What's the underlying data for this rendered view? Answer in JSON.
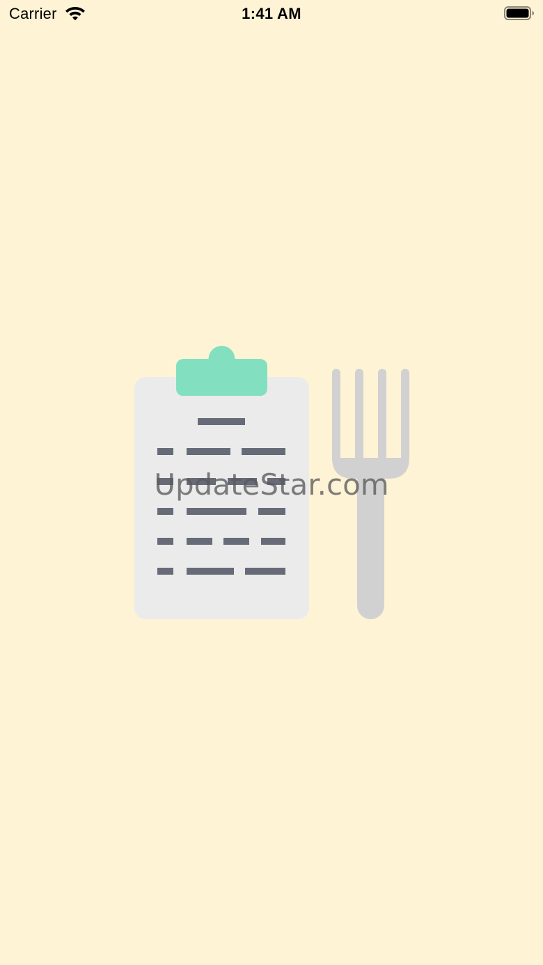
{
  "status_bar": {
    "carrier": "Carrier",
    "time": "1:41 AM",
    "wifi_icon": "wifi-icon",
    "battery_icon": "battery-full-icon"
  },
  "splash": {
    "illustration_icons": [
      "clipboard-menu-icon",
      "fork-icon"
    ],
    "watermark": "UpdateStar.com"
  },
  "colors": {
    "background": "#FEF3D5",
    "clipboard_paper": "#EBEBEB",
    "clipboard_clip": "#82E0C0",
    "text_lines": "#676B78",
    "fork": "#D1D1D1"
  }
}
